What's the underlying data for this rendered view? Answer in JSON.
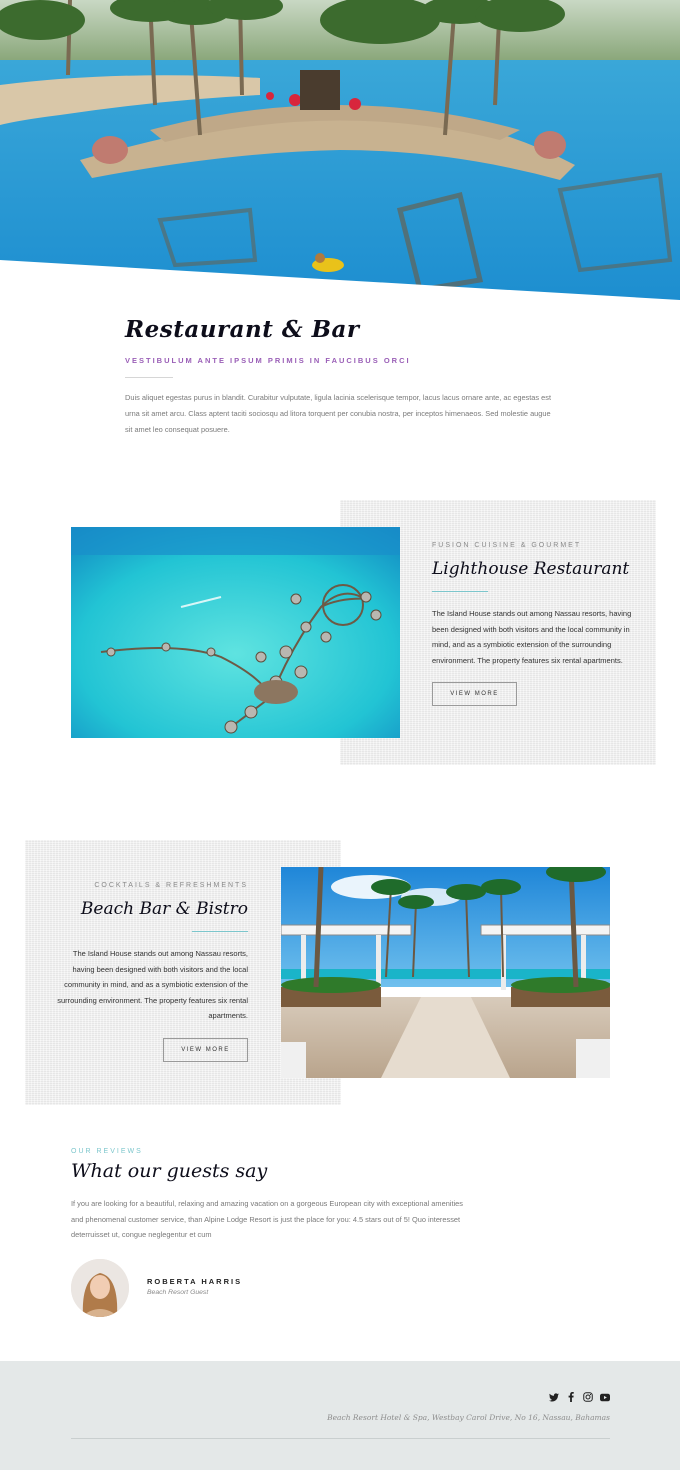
{
  "intro": {
    "title": "Restaurant & Bar",
    "subtitle": "VESTIBULUM ANTE IPSUM PRIMIS IN FAUCIBUS ORCI",
    "text": "Duis aliquet egestas purus in blandit. Curabitur vulputate, ligula lacinia scelerisque tempor, lacus lacus ornare ante, ac egestas est urna sit amet arcu. Class aptent taciti sociosqu ad litora torquent per conubia nostra, per inceptos himenaeos. Sed molestie augue sit amet leo consequat posuere."
  },
  "venues": [
    {
      "eyebrow": "FUSION CUISINE & GOURMET",
      "title": "Lighthouse Restaurant",
      "text": "The Island House stands out among Nassau resorts, having been designed with both visitors and the local community in mind, and as a symbiotic extension of the surrounding environment. The property features six rental apartments.",
      "button": "VIEW MORE"
    },
    {
      "eyebrow": "COCKTAILS & REFRESHMENTS",
      "title": "Beach Bar & Bistro",
      "text": "The Island House stands out among Nassau resorts, having been designed with both visitors and the local community in mind, and as a symbiotic extension of the surrounding environment. The property features six rental apartments.",
      "button": "VIEW MORE"
    }
  ],
  "reviews": {
    "eyebrow": "OUR REVIEWS",
    "title": "What our guests say",
    "text": "If you are looking for a beautiful, relaxing and amazing vacation on a gorgeous European city with exceptional amenities and phenomenal customer service, than Alpine Lodge Resort is just the place for you: 4.5 stars out of 5! Quo interesset deterruisset ut, congue neglegentur et cum",
    "author_name": "ROBERTA HARRIS",
    "author_role": "Beach Resort Guest"
  },
  "footer": {
    "socials": [
      "twitter-icon",
      "facebook-icon",
      "instagram-icon",
      "youtube-icon"
    ],
    "address": "Beach Resort Hotel & Spa, Westbay Carol Drive, No 16, Nassau, Bahamas"
  },
  "colors": {
    "accent_purple": "#9a5fb7",
    "accent_teal": "#7cc6cc",
    "panel_bg": "#efefef",
    "footer_bg": "#e4e8e8"
  }
}
